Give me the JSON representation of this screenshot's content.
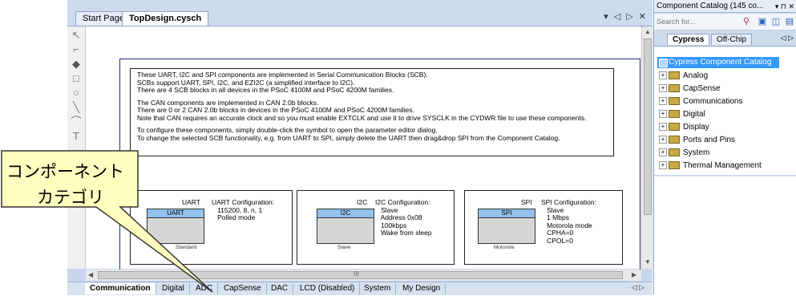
{
  "doc_tabs": [
    {
      "label": "Start Page"
    },
    {
      "label": "TopDesign.cysch"
    }
  ],
  "doc_controls": "▾ ◁ ▷ ✕",
  "notes": [
    "These UART, I2C and SPI components are implemented in Serial Communication Blocks (SCB).",
    "SCBs support UART, SPI, I2C, and EZI2C (a simplified interface to I2C).",
    "There are 4 SCB blocks in all devices in the PSoC 4100M and PSoC 4200M families.",
    "The CAN components are implemented in CAN 2.0b blocks.",
    "There are 0 or 2 CAN 2.0b blocks in devices in the PSoC 4100M and PSoC 4200M families.",
    "Note that CAN requires an accurate clock and so you must enable EXTCLK and use it to drive SYSCLK in the CYDWR file to use these components.",
    "To configure these components, simply double-click the symbol to open the parameter editor dialog.",
    "To change the selected SCB functionality, e.g. from UART to SPI, simply delete the UART then drag&drop SPI from the Component Catalog."
  ],
  "components": [
    {
      "title": "UART",
      "block": "UART",
      "footer": "Standard",
      "config": "UART Configuration:\n   115200, 8, n, 1\n   Polled mode"
    },
    {
      "title": "I2C",
      "block": "I2C",
      "footer": "Slave",
      "config": "I2C Configuration:\n   Slave\n   Address 0x08\n   100kbps\n   Wake from sleep"
    },
    {
      "title": "SPI",
      "block": "SPI",
      "footer": "Motorola",
      "config": "SPI Configuration:\n   Slave\n   1 Mbps\n   Motorola mode\n   CPHA=0\n   CPOL=0"
    }
  ],
  "hscroll_label": "III",
  "sheet_tabs": [
    {
      "label": "Communication"
    },
    {
      "label": "Digital"
    },
    {
      "label": "ADC"
    },
    {
      "label": "CapSense"
    },
    {
      "label": "DAC"
    },
    {
      "label": "LCD (Disabled)"
    },
    {
      "label": "System"
    },
    {
      "label": "My Design"
    }
  ],
  "sheet_tabs_nav": "◁ ▷",
  "catalog": {
    "title": "Component Catalog (145 co...",
    "title_controls": "▾ ⊓ ✕",
    "search_placeholder": "Search for...",
    "tabs": [
      {
        "label": "Cypress"
      },
      {
        "label": "Off-Chip"
      }
    ],
    "tabs_nav": "◁ ▷",
    "root": "Cypress Component Catalog",
    "items": [
      {
        "label": "Analog"
      },
      {
        "label": "CapSense"
      },
      {
        "label": "Communications"
      },
      {
        "label": "Digital"
      },
      {
        "label": "Display"
      },
      {
        "label": "Ports and Pins"
      },
      {
        "label": "System"
      },
      {
        "label": "Thermal Management"
      }
    ]
  },
  "callout": {
    "line1": "コンポーネント",
    "line2": "カテゴリ",
    "fill": "#ffffc0"
  }
}
